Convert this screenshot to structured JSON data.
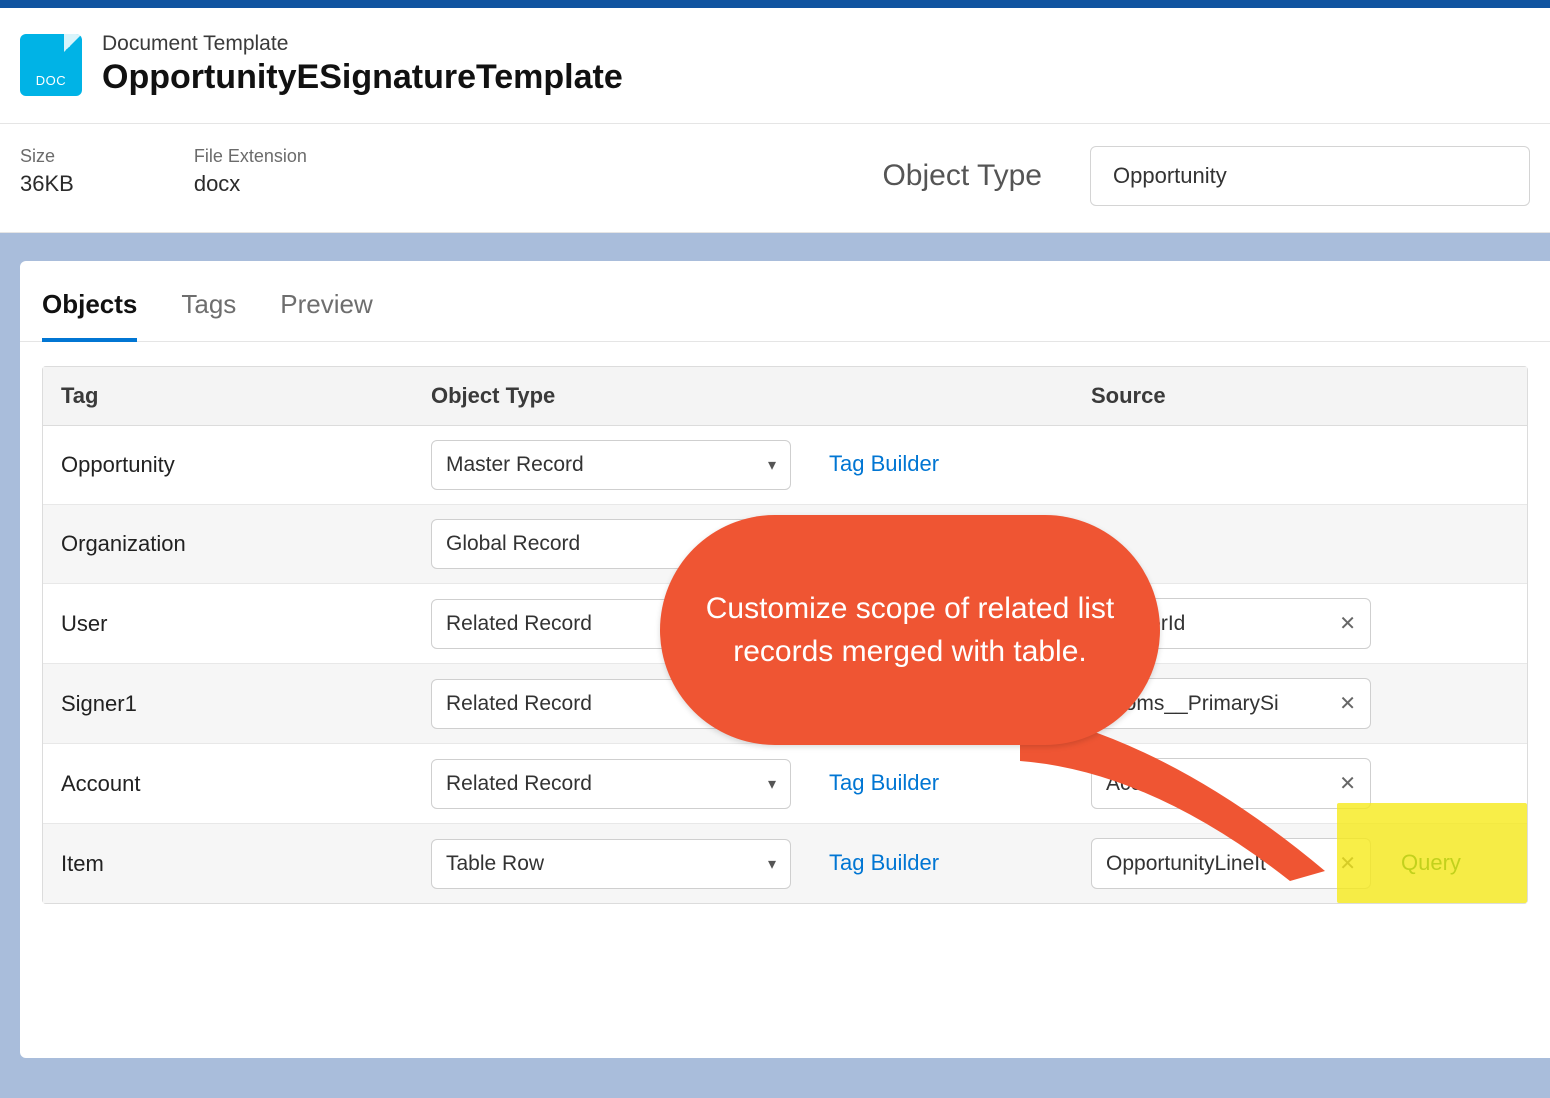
{
  "header": {
    "icon_text": "DOC",
    "kicker": "Document Template",
    "title": "OpportunityESignatureTemplate"
  },
  "info": {
    "size_label": "Size",
    "size_value": "36KB",
    "ext_label": "File Extension",
    "ext_value": "docx",
    "object_type_label": "Object Type",
    "object_type_value": "Opportunity"
  },
  "tabs": {
    "objects": "Objects",
    "tags": "Tags",
    "preview": "Preview"
  },
  "table": {
    "headers": {
      "tag": "Tag",
      "object_type": "Object Type",
      "source": "Source"
    },
    "tag_builder_label": "Tag Builder",
    "query_label": "Query",
    "rows": [
      {
        "tag": "Opportunity",
        "object_type": "Master Record",
        "has_builder": true,
        "source": ""
      },
      {
        "tag": "Organization",
        "object_type": "Global Record",
        "has_builder": false,
        "source": ""
      },
      {
        "tag": "User",
        "object_type": "Related Record",
        "has_builder": false,
        "source": "OwnerId"
      },
      {
        "tag": "Signer1",
        "object_type": "Related Record",
        "has_builder": false,
        "source": "rooms__PrimarySi"
      },
      {
        "tag": "Account",
        "object_type": "Related Record",
        "has_builder": true,
        "source": "Accounti"
      },
      {
        "tag": "Item",
        "object_type": "Table Row",
        "has_builder": true,
        "source": "OpportunityLineIt",
        "has_query": true
      }
    ]
  },
  "callout": {
    "text": "Customize scope of related list records merged with table."
  }
}
